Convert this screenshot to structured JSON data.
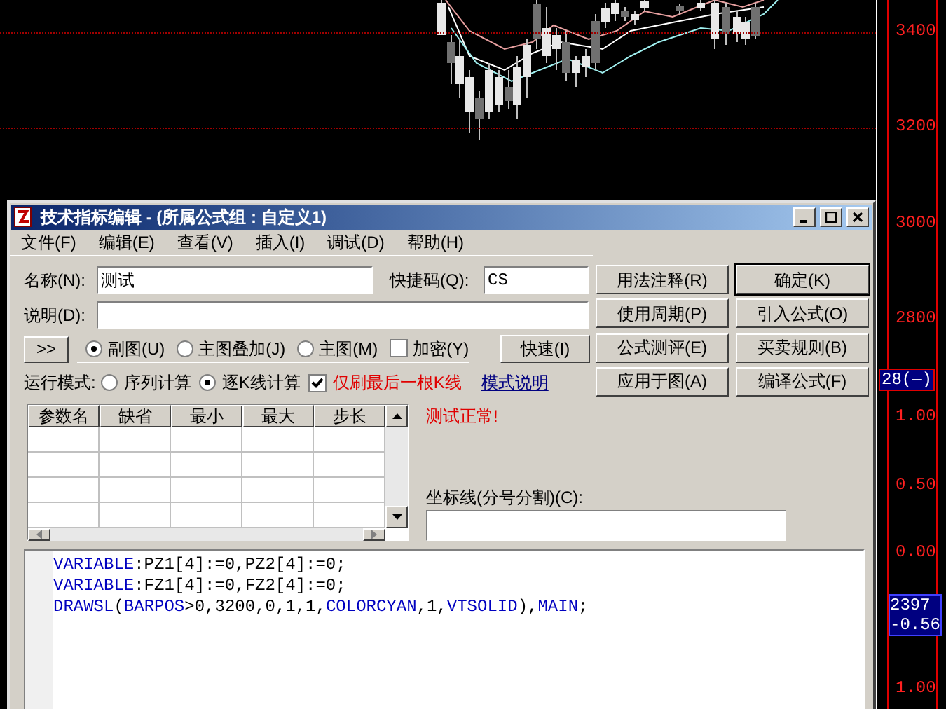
{
  "price_axis": {
    "labels": [
      "3400",
      "3200",
      "3000",
      "2800"
    ],
    "current_value": "28(—)"
  },
  "indicator_axis": {
    "labels": [
      "1.00",
      "0.50",
      "0.00",
      "1.00"
    ],
    "current_value": [
      "2397",
      "-0.56"
    ]
  },
  "window": {
    "title": "技术指标编辑 - (所属公式组 : 自定义1)"
  },
  "menu": [
    "文件(F)",
    "编辑(E)",
    "查看(V)",
    "插入(I)",
    "调试(D)",
    "帮助(H)"
  ],
  "form": {
    "name_label": "名称(N):",
    "name_value": "测试",
    "shortcut_label": "快捷码(Q):",
    "shortcut_value": "CS",
    "desc_label": "说明(D):"
  },
  "expand_button": ">>",
  "chart_type": [
    {
      "label": "副图(U)",
      "selected": true
    },
    {
      "label": "主图叠加(J)",
      "selected": false
    },
    {
      "label": "主图(M)",
      "selected": false
    }
  ],
  "encrypt": {
    "label": "加密(Y)",
    "checked": false
  },
  "fast_button": "快速(I)",
  "run_mode": {
    "label": "运行模式:",
    "options": [
      {
        "label": "序列计算",
        "selected": false
      },
      {
        "label": "逐K线计算",
        "selected": true
      }
    ]
  },
  "refresh_last": {
    "label": "仅刷最后一根K线",
    "checked": true
  },
  "mode_link": "模式说明",
  "side_buttons": [
    {
      "label": "用法注释(R)",
      "default": false
    },
    {
      "label": "确定(K)",
      "default": true
    },
    {
      "label": "使用周期(P)",
      "default": false
    },
    {
      "label": "引入公式(O)",
      "default": false
    },
    {
      "label": "公式测评(E)",
      "default": false
    },
    {
      "label": "买卖规则(B)",
      "default": false
    },
    {
      "label": "应用于图(A)",
      "default": false
    },
    {
      "label": "编译公式(F)",
      "default": false
    }
  ],
  "param_table": {
    "columns": [
      "参数名",
      "缺省",
      "最小",
      "最大",
      "步长"
    ]
  },
  "status_message": "测试正常!",
  "axis_lines": {
    "label": "坐标线(分号分割)(C):"
  },
  "code": [
    [
      {
        "text": "VARIABLE",
        "kind": "keyword"
      },
      {
        "text": ":PZ1[4]:=0,PZ2[4]:=0;",
        "kind": "plain"
      }
    ],
    [
      {
        "text": "VARIABLE",
        "kind": "keyword"
      },
      {
        "text": ":FZ1[4]:=0,FZ2[4]:=0;",
        "kind": "plain"
      }
    ],
    [
      {
        "text": "DRAWSL",
        "kind": "keyword"
      },
      {
        "text": "(",
        "kind": "plain"
      },
      {
        "text": "BARPOS",
        "kind": "keyword"
      },
      {
        "text": ">0,3200,0,1,1,",
        "kind": "plain"
      },
      {
        "text": "COLORCYAN",
        "kind": "keyword"
      },
      {
        "text": ",1,",
        "kind": "plain"
      },
      {
        "text": "VTSOLID",
        "kind": "keyword"
      },
      {
        "text": "),",
        "kind": "plain"
      },
      {
        "text": "MAIN",
        "kind": "keyword"
      },
      {
        "text": ";",
        "kind": "plain"
      }
    ]
  ]
}
